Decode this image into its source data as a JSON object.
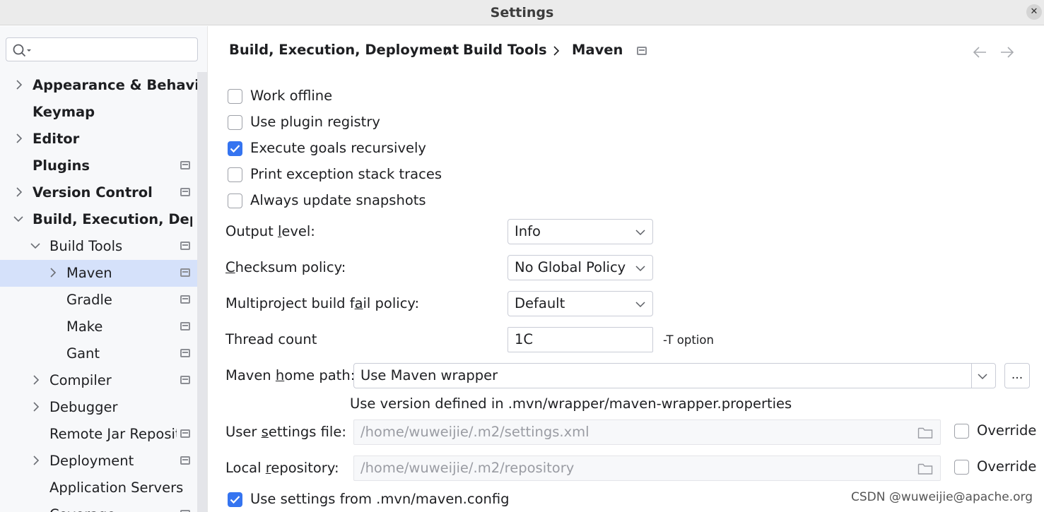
{
  "window": {
    "title": "Settings",
    "close_glyph": "✕"
  },
  "search": {
    "placeholder": ""
  },
  "sidebar": {
    "items": [
      {
        "label": "Appearance & Behavior"
      },
      {
        "label": "Keymap"
      },
      {
        "label": "Editor"
      },
      {
        "label": "Plugins"
      },
      {
        "label": "Version Control"
      },
      {
        "label": "Build, Execution, Deployment"
      },
      {
        "label": "Build Tools"
      },
      {
        "label": "Maven"
      },
      {
        "label": "Gradle"
      },
      {
        "label": "Make"
      },
      {
        "label": "Gant"
      },
      {
        "label": "Compiler"
      },
      {
        "label": "Debugger"
      },
      {
        "label": "Remote Jar Repositories"
      },
      {
        "label": "Deployment"
      },
      {
        "label": "Application Servers"
      },
      {
        "label": "Coverage"
      }
    ]
  },
  "breadcrumb": {
    "items": [
      "Build, Execution, Deployment",
      "Build Tools",
      "Maven"
    ]
  },
  "options": {
    "work_offline": {
      "label": "Work offline",
      "checked": false
    },
    "use_plugin_registry": {
      "label": "Use plugin registry",
      "checked": false
    },
    "execute_goals_recursively": {
      "label": "Execute goals recursively",
      "checked": true
    },
    "print_exception_stack_traces": {
      "label": "Print exception stack traces",
      "checked": false
    },
    "always_update_snapshots": {
      "label": "Always update snapshots",
      "checked": false
    }
  },
  "output_level": {
    "label_pre": "Output ",
    "label_mnemonic": "l",
    "label_post": "evel:",
    "value": "Info"
  },
  "checksum_policy": {
    "label_pre": "",
    "label_mnemonic": "C",
    "label_post": "hecksum policy:",
    "value": "No Global Policy"
  },
  "multiproject_fail_policy": {
    "label_pre": "Multiproject build f",
    "label_mnemonic": "a",
    "label_post": "il policy:",
    "value": "Default"
  },
  "thread_count": {
    "label": "Thread count",
    "value": "1C",
    "hint": "-T option"
  },
  "maven_home": {
    "label_pre": "Maven ",
    "label_mnemonic": "h",
    "label_post": "ome path:",
    "value": "Use Maven wrapper",
    "browse_label": "...",
    "note": "Use version defined in .mvn/wrapper/maven-wrapper.properties"
  },
  "user_settings": {
    "label_pre": "User ",
    "label_mnemonic": "s",
    "label_post": "ettings file:",
    "value": "/home/wuweijie/.m2/settings.xml",
    "override_label": "Override",
    "override_checked": false
  },
  "local_repository": {
    "label_pre": "Local ",
    "label_mnemonic": "r",
    "label_post": "epository:",
    "value": "/home/wuweijie/.m2/repository",
    "override_label": "Override",
    "override_checked": false
  },
  "use_mvn_config": {
    "label": "Use settings from .mvn/maven.config",
    "checked": true
  },
  "watermark": "CSDN @wuweijie@apache.org",
  "colors": {
    "accent": "#3574f0",
    "selection": "#d5e1fa",
    "sidebar_bg": "#f7f8fa"
  }
}
